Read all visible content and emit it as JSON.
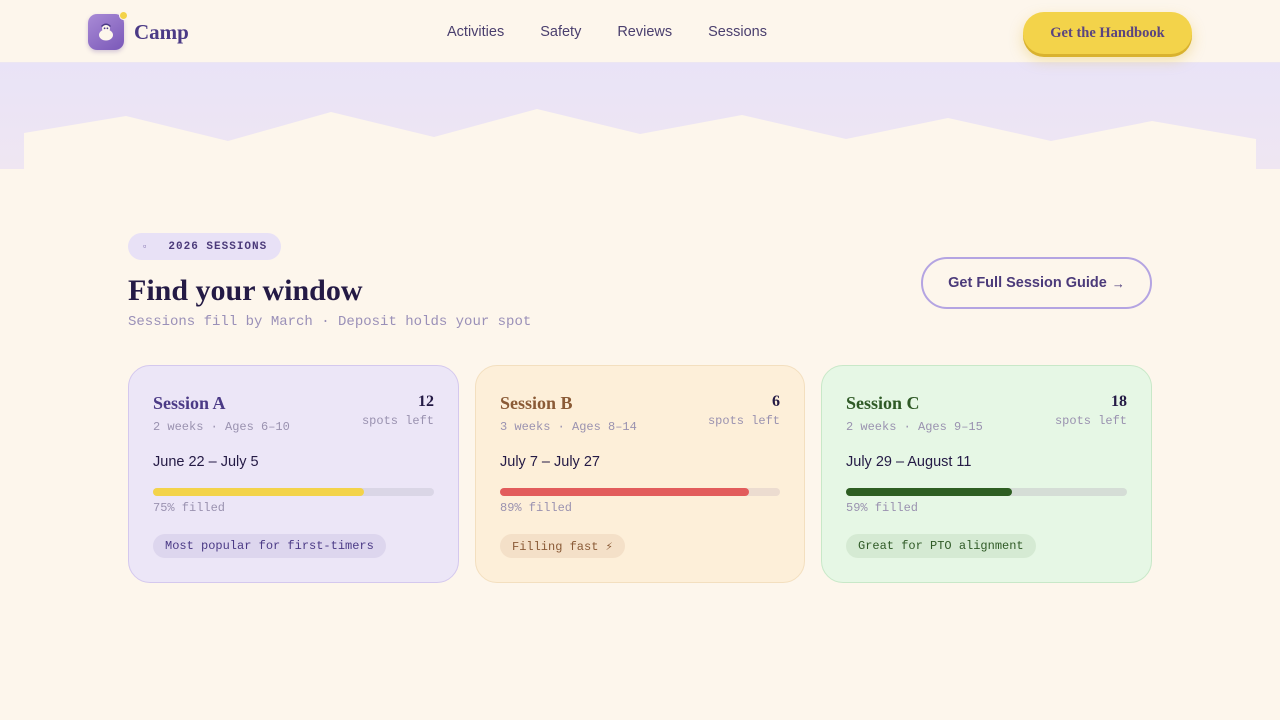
{
  "header": {
    "brand": "Camp",
    "nav": [
      "Activities",
      "Safety",
      "Reviews",
      "Sessions"
    ],
    "cta_label": "Get the Handbook"
  },
  "section": {
    "eyebrow_icon": "calendar-icon",
    "eyebrow_icon_glyph": "▫",
    "eyebrow": "2026 SESSIONS",
    "title": "Find your window",
    "subtitle": "Sessions fill by March · Deposit holds your spot",
    "guide_label": "Get Full Session Guide",
    "guide_arrow": "→"
  },
  "sessions": [
    {
      "name": "Session A",
      "meta": "2 weeks · Ages 6–10",
      "spots": "12",
      "spots_label": "spots left",
      "dates": "June 22 – July 5",
      "fill_fraction": 0.75,
      "fill_color": "#f3d34a",
      "filled_label": "75% filled",
      "tag": "Most popular for first-timers"
    },
    {
      "name": "Session B",
      "meta": "3 weeks · Ages 8–14",
      "spots": "6",
      "spots_label": "spots left",
      "dates": "July 7 – July 27",
      "fill_fraction": 0.89,
      "fill_color": "#e25c5c",
      "filled_label": "89% filled",
      "tag": "Filling fast ⚡"
    },
    {
      "name": "Session C",
      "meta": "2 weeks · Ages 9–15",
      "spots": "18",
      "spots_label": "spots left",
      "dates": "July 29 – August 11",
      "fill_fraction": 0.59,
      "fill_color": "#2e5e22",
      "filled_label": "59% filled",
      "tag": "Great for PTO alignment"
    }
  ]
}
